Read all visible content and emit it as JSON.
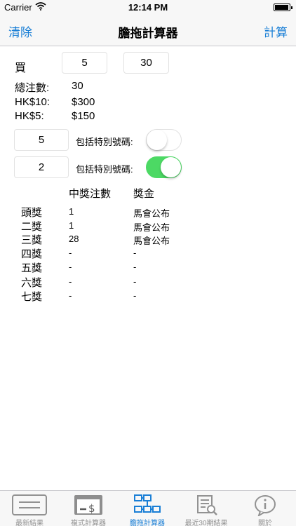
{
  "status_bar": {
    "carrier": "Carrier",
    "time": "12:14 PM",
    "battery_level": 0.95
  },
  "nav": {
    "left": "清除",
    "title": "膽拖計算器",
    "right": "計算"
  },
  "buy": {
    "label": "買",
    "banker": "5",
    "legs": "30"
  },
  "summary": {
    "total_label": "總注數:",
    "total_value": "30",
    "hk10_label": "HK$10:",
    "hk10_value": "$300",
    "hk5_label": "HK$5:",
    "hk5_value": "$150"
  },
  "special": [
    {
      "value": "5",
      "label": "包括特別號碼:",
      "on": false
    },
    {
      "value": "2",
      "label": "包括特別號碼:",
      "on": true
    }
  ],
  "prize_table": {
    "header_count": "中獎注數",
    "header_prize": "獎金",
    "rows": [
      {
        "name": "頭獎",
        "count": "1",
        "prize": "馬會公布"
      },
      {
        "name": "二獎",
        "count": "1",
        "prize": "馬會公布"
      },
      {
        "name": "三獎",
        "count": "28",
        "prize": "馬會公布"
      },
      {
        "name": "四獎",
        "count": "-",
        "prize": "-"
      },
      {
        "name": "五獎",
        "count": "-",
        "prize": "-"
      },
      {
        "name": "六獎",
        "count": "-",
        "prize": "-"
      },
      {
        "name": "七獎",
        "count": "-",
        "prize": "-"
      }
    ]
  },
  "tabs": [
    {
      "label": "最新結果",
      "icon": "ticket-icon",
      "active": false
    },
    {
      "label": "複式計算器",
      "icon": "calculator-dollar-icon",
      "active": false
    },
    {
      "label": "膽拖計算器",
      "icon": "flow-diagram-icon",
      "active": true
    },
    {
      "label": "最近30期結果",
      "icon": "document-search-icon",
      "active": false
    },
    {
      "label": "關於",
      "icon": "info-icon",
      "active": false
    }
  ],
  "colors": {
    "accent": "#1a7fd6",
    "toggle_on": "#4cd964",
    "tab_inactive": "#929292"
  }
}
